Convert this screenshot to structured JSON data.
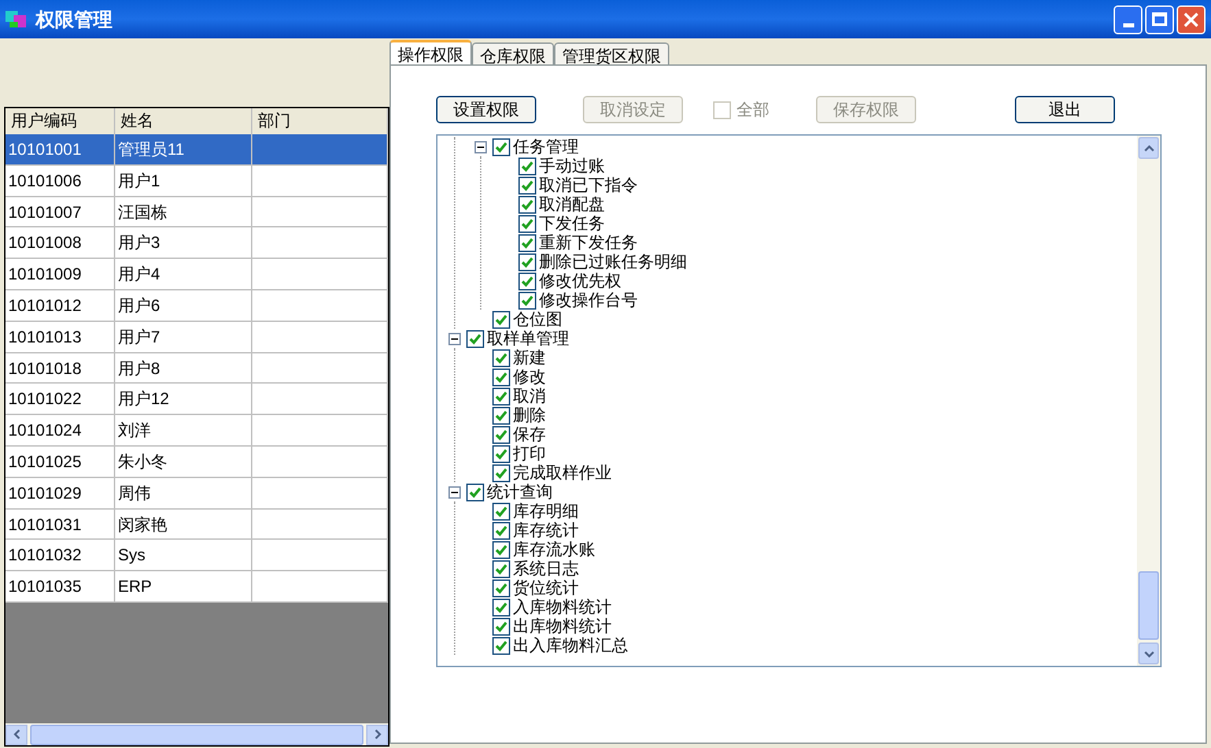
{
  "window": {
    "title": "权限管理"
  },
  "users_table": {
    "columns": [
      "用户编码",
      "姓名",
      "部门"
    ],
    "rows": [
      {
        "cells": [
          "10101001",
          "管理员11",
          ""
        ],
        "selected": true
      },
      {
        "cells": [
          "10101006",
          "用户1",
          ""
        ],
        "selected": false
      },
      {
        "cells": [
          "10101007",
          "汪国栋",
          ""
        ],
        "selected": false
      },
      {
        "cells": [
          "10101008",
          "用户3",
          ""
        ],
        "selected": false
      },
      {
        "cells": [
          "10101009",
          "用户4",
          ""
        ],
        "selected": false
      },
      {
        "cells": [
          "10101012",
          "用户6",
          ""
        ],
        "selected": false
      },
      {
        "cells": [
          "10101013",
          "用户7",
          ""
        ],
        "selected": false
      },
      {
        "cells": [
          "10101018",
          "用户8",
          ""
        ],
        "selected": false
      },
      {
        "cells": [
          "10101022",
          "用户12",
          ""
        ],
        "selected": false
      },
      {
        "cells": [
          "10101024",
          "刘洋",
          ""
        ],
        "selected": false
      },
      {
        "cells": [
          "10101025",
          "朱小冬",
          ""
        ],
        "selected": false
      },
      {
        "cells": [
          "10101029",
          "周伟",
          ""
        ],
        "selected": false
      },
      {
        "cells": [
          "10101031",
          "闵家艳",
          ""
        ],
        "selected": false
      },
      {
        "cells": [
          "10101032",
          "Sys",
          ""
        ],
        "selected": false
      },
      {
        "cells": [
          "10101035",
          "ERP",
          ""
        ],
        "selected": false
      }
    ]
  },
  "tabs": [
    {
      "label": "操作权限",
      "selected": true
    },
    {
      "label": "仓库权限",
      "selected": false
    },
    {
      "label": "管理货区权限",
      "selected": false
    }
  ],
  "toolbar": [
    {
      "kind": "button",
      "label": "设置权限",
      "disabled": false
    },
    {
      "kind": "button",
      "label": "取消设定",
      "disabled": true
    },
    {
      "kind": "checkbox",
      "label": "全部",
      "checked": false
    },
    {
      "kind": "button",
      "label": "保存权限",
      "disabled": true
    },
    {
      "kind": "spacer"
    },
    {
      "kind": "button",
      "label": "退出",
      "disabled": false
    }
  ],
  "tree": [
    {
      "children": [
        {
          "label": "任务管理",
          "checked": true,
          "expanded": true,
          "children": [
            {
              "label": "手动过账",
              "checked": true
            },
            {
              "label": "取消已下指令",
              "checked": true
            },
            {
              "label": "取消配盘",
              "checked": true
            },
            {
              "label": "下发任务",
              "checked": true
            },
            {
              "label": "重新下发任务",
              "checked": true
            },
            {
              "label": "删除已过账任务明细",
              "checked": true
            },
            {
              "label": "修改优先权",
              "checked": true
            },
            {
              "label": "修改操作台号",
              "checked": true
            }
          ]
        },
        {
          "label": "仓位图",
          "checked": true
        }
      ]
    },
    {
      "label": "取样单管理",
      "checked": true,
      "expanded": true,
      "children": [
        {
          "label": "新建",
          "checked": true
        },
        {
          "label": "修改",
          "checked": true
        },
        {
          "label": "取消",
          "checked": true
        },
        {
          "label": "删除",
          "checked": true
        },
        {
          "label": "保存",
          "checked": true
        },
        {
          "label": "打印",
          "checked": true
        },
        {
          "label": "完成取样作业",
          "checked": true
        }
      ]
    },
    {
      "label": "统计查询",
      "checked": true,
      "expanded": true,
      "children": [
        {
          "label": "库存明细",
          "checked": true
        },
        {
          "label": "库存统计",
          "checked": true
        },
        {
          "label": "库存流水账",
          "checked": true
        },
        {
          "label": "系统日志",
          "checked": true
        },
        {
          "label": "货位统计",
          "checked": true
        },
        {
          "label": "入库物料统计",
          "checked": true
        },
        {
          "label": "出库物料统计",
          "checked": true
        },
        {
          "label": "出入库物料汇总",
          "checked": true
        }
      ]
    }
  ]
}
